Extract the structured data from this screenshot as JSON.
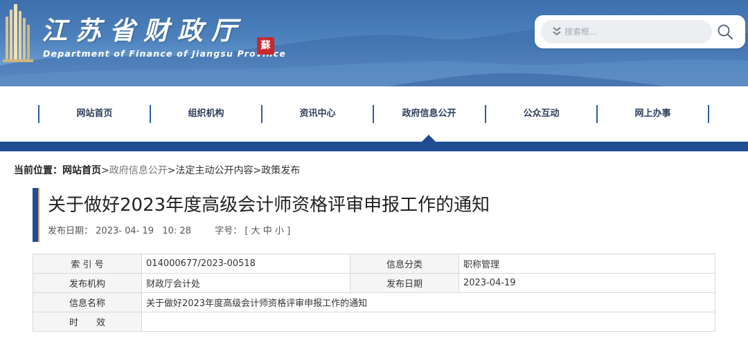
{
  "header": {
    "site_title": "江苏省财政厅",
    "site_subtitle": "Department of Finance of Jiangsu Province",
    "seal_text": "蘇",
    "brand_color": "#1f4d94"
  },
  "search": {
    "placeholder": "搜索框..."
  },
  "nav": {
    "items": [
      {
        "label": "网站首页"
      },
      {
        "label": "组织机构"
      },
      {
        "label": "资讯中心"
      },
      {
        "label": "政府信息公开"
      },
      {
        "label": "公众互动"
      },
      {
        "label": "网上办事"
      }
    ],
    "active_index": 3
  },
  "breadcrumb": {
    "prefix": "当前位置：",
    "home": "网站首页",
    "sep": ">",
    "items": [
      "政府信息公开",
      "法定主动公开内容",
      "政策发布"
    ]
  },
  "article": {
    "title": "关于做好2023年度高级会计师资格评审申报工作的通知",
    "publish_label": "发布日期：",
    "publish_value": "2023- 04- 19   10: 28",
    "font_label": "字号：",
    "font_open": "[",
    "font_large": "大",
    "font_medium": "中",
    "font_small": "小",
    "font_close": "]"
  },
  "info_table": {
    "rows": [
      {
        "k1": "索 引 号",
        "v1": "014000677/2023-00518",
        "k2": "信息分类",
        "v2": "职称管理"
      },
      {
        "k1": "发布机构",
        "v1": "财政厅会计处",
        "k2": "发布日期",
        "v2": "2023-04-19"
      },
      {
        "k1": "信息名称",
        "v1": "关于做好2023年度高级会计师资格评审申报工作的通知"
      },
      {
        "k1": "时　　效",
        "v1": ""
      }
    ]
  }
}
